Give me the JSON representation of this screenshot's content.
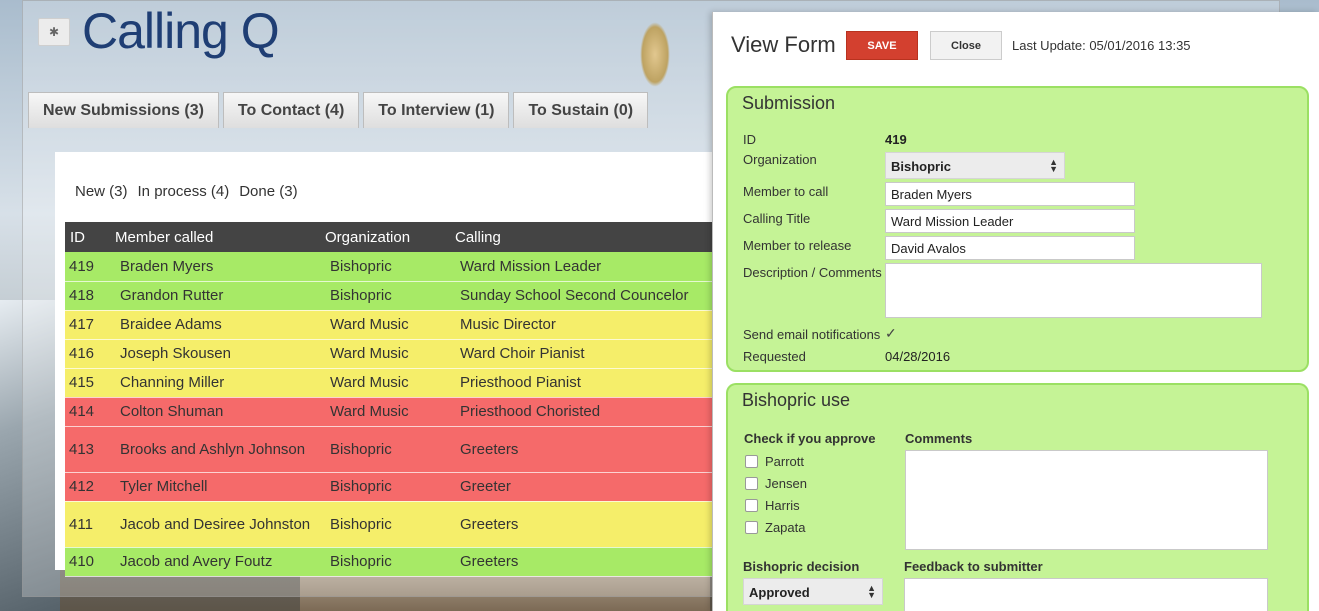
{
  "app": {
    "logo": "Calling Q",
    "gear_icon": "gear-icon"
  },
  "tabs": [
    "New Submissions (3)",
    "To Contact (4)",
    "To Interview (1)",
    "To Sustain (0)"
  ],
  "filters": [
    "New (3)",
    "In process (4)",
    "Done (3)"
  ],
  "table": {
    "headers": [
      "ID",
      "Member called",
      "Organization",
      "Calling"
    ],
    "rows": [
      {
        "id": "419",
        "member": "Braden Myers",
        "org": "Bishopric",
        "calling": "Ward Mission Leader",
        "status": "green"
      },
      {
        "id": "418",
        "member": "Grandon Rutter",
        "org": "Bishopric",
        "calling": "Sunday School Second Councelor",
        "status": "green"
      },
      {
        "id": "417",
        "member": "Braidee Adams",
        "org": "Ward Music",
        "calling": "Music Director",
        "status": "yellow"
      },
      {
        "id": "416",
        "member": "Joseph Skousen",
        "org": "Ward Music",
        "calling": "Ward Choir Pianist",
        "status": "yellow"
      },
      {
        "id": "415",
        "member": "Channing Miller",
        "org": "Ward Music",
        "calling": "Priesthood Pianist",
        "status": "yellow"
      },
      {
        "id": "414",
        "member": "Colton Shuman",
        "org": "Ward Music",
        "calling": "Priesthood Choristed",
        "status": "red"
      },
      {
        "id": "413",
        "member": "Brooks and Ashlyn Johnson",
        "org": "Bishopric",
        "calling": "Greeters",
        "status": "red"
      },
      {
        "id": "412",
        "member": "Tyler Mitchell",
        "org": "Bishopric",
        "calling": "Greeter",
        "status": "red"
      },
      {
        "id": "411",
        "member": "Jacob and Desiree Johnston",
        "org": "Bishopric",
        "calling": "Greeters",
        "status": "yellow"
      },
      {
        "id": "410",
        "member": "Jacob and Avery Foutz",
        "org": "Bishopric",
        "calling": "Greeters",
        "status": "green"
      }
    ],
    "status_colors": {
      "green": "#a7ea66",
      "yellow": "#f5ee6a",
      "red": "#f56a6a"
    }
  },
  "panel": {
    "title": "View Form",
    "save_label": "SAVE",
    "close_label": "Close",
    "last_update": "Last Update: 05/01/2016 13:35",
    "submission": {
      "title": "Submission",
      "id_label": "ID",
      "id_value": "419",
      "org_label": "Organization",
      "org_value": "Bishopric",
      "member_label": "Member to call",
      "member_value": "Braden Myers",
      "calling_label": "Calling Title",
      "calling_value": "Ward Mission Leader",
      "release_label": "Member to release",
      "release_value": "David Avalos",
      "desc_label": "Description / Comments",
      "email_label": "Send email notifications",
      "email_checked": "✓",
      "requested_label": "Requested",
      "requested_value": "04/28/2016"
    },
    "bishopric": {
      "title": "Bishopric use",
      "approve_label": "Check if you approve",
      "approvers": [
        "Parrott",
        "Jensen",
        "Harris",
        "Zapata"
      ],
      "comments_label": "Comments",
      "decision_label": "Bishopric decision",
      "decision_value": "Approved",
      "feedback_label": "Feedback to submitter"
    },
    "accent_save": "#d3402f",
    "card_color": "#c5f396"
  }
}
